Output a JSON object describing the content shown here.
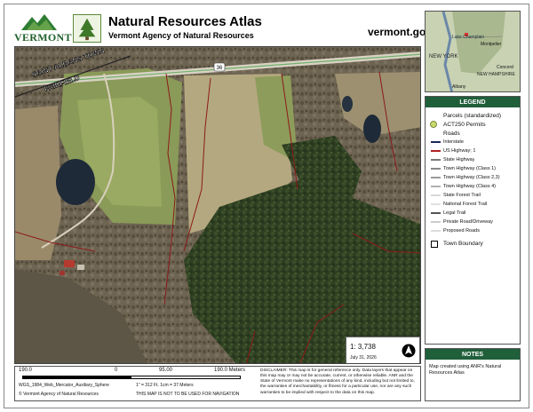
{
  "header": {
    "logo_word": "VERMONT",
    "title": "Natural Resources Atlas",
    "subtitle": "Vermont Agency of Natural Resources",
    "site": "vermont.gov"
  },
  "map": {
    "town_label_1": "SAINT ALBANS TOWN",
    "town_label_2": "FAIRFIELD",
    "route_shield": "36"
  },
  "inset": {
    "labels": [
      "Lake Champlain",
      "Montpelier",
      "NEW YORK",
      "Concord",
      "NEW HAMPSHIRE",
      "Albany"
    ]
  },
  "legend": {
    "title": "LEGEND",
    "items": [
      {
        "label": "Parcels (standardized)",
        "kind": "text"
      },
      {
        "label": "ACT250 Permits",
        "kind": "act250"
      },
      {
        "label": "Roads",
        "kind": "text"
      },
      {
        "label": "Interstate",
        "kind": "road",
        "color": "#1a2a5a"
      },
      {
        "label": "US Highway; 1",
        "kind": "road",
        "color": "#b22222"
      },
      {
        "label": "State Highway",
        "kind": "road",
        "color": "#7a7a7a"
      },
      {
        "label": "Town Highway (Class 1)",
        "kind": "road",
        "color": "#8a8a8a"
      },
      {
        "label": "Town Highway (Class 2,3)",
        "kind": "road",
        "color": "#9a9a9a"
      },
      {
        "label": "Town Highway (Class 4)",
        "kind": "road",
        "color": "#b0b0b0"
      },
      {
        "label": "State Forest Trail",
        "kind": "road",
        "color": "#d8d8d8"
      },
      {
        "label": "National Forest Trail",
        "kind": "road",
        "color": "#e0e0e0"
      },
      {
        "label": "Legal Trail",
        "kind": "road",
        "color": "#555555"
      },
      {
        "label": "Private Road/Driveway",
        "kind": "road",
        "color": "#cccccc"
      },
      {
        "label": "Proposed Roads",
        "kind": "road",
        "color": "#dddddd"
      },
      {
        "label": "Town Boundary",
        "kind": "town"
      }
    ]
  },
  "scale": {
    "ratio": "1:  3,738",
    "date": "July 31, 2026"
  },
  "notes": {
    "title": "NOTES",
    "text": "Map created using ANR's Natural Resources Atlas"
  },
  "scalebar": {
    "left": "190.0",
    "zero": "0",
    "mid": "95.00",
    "right": "190.0 Meters",
    "projection": "WGS_1984_Web_Mercator_Auxiliary_Sphere",
    "conversion": "1\" =      312    Ft.        1cm =      37    Meters",
    "copyright": "© Vermont Agency of Natural Resources",
    "nav": "THIS MAP IS NOT TO BE USED FOR NAVIGATION"
  },
  "disclaimer": "DISCLAIMER: This map is for general reference only. Data layers that appear on this map may or may not be accurate, current, or otherwise reliable. ANR and the State of Vermont make no representations of any kind, including but not limited to, the warranties of merchantability, or fitness for a particular use, nor are any such warranties to be implied with respect to the data on this map."
}
